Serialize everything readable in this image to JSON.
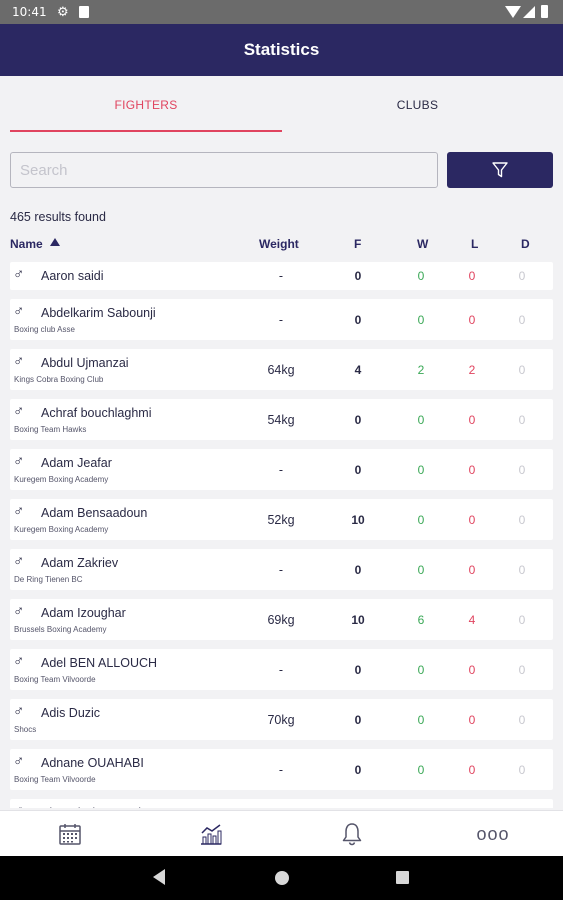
{
  "status_bar": {
    "time": "10:41"
  },
  "app_bar": {
    "title": "Statistics"
  },
  "tabs": [
    {
      "label": "FIGHTERS",
      "active": true
    },
    {
      "label": "CLUBS",
      "active": false
    }
  ],
  "search": {
    "placeholder": "Search",
    "value": ""
  },
  "filter_icon": "funnel-icon",
  "results_text": "465 results found",
  "columns": {
    "name": "Name",
    "weight": "Weight",
    "fights": "F",
    "wins": "W",
    "losses": "L",
    "draws": "D",
    "sort": "ascending"
  },
  "fighters": [
    {
      "name": "Aaron saidi",
      "club": "",
      "weight": "-",
      "f": "0",
      "w": "0",
      "l": "0",
      "d": "0"
    },
    {
      "name": "Abdelkarim Sabounji",
      "club": "Boxing club Asse",
      "weight": "-",
      "f": "0",
      "w": "0",
      "l": "0",
      "d": "0"
    },
    {
      "name": "Abdul Ujmanzai",
      "club": "Kings Cobra Boxing Club",
      "weight": "64kg",
      "f": "4",
      "w": "2",
      "l": "2",
      "d": "0"
    },
    {
      "name": "Achraf bouchlaghmi",
      "club": "Boxing Team Hawks",
      "weight": "54kg",
      "f": "0",
      "w": "0",
      "l": "0",
      "d": "0"
    },
    {
      "name": "Adam Jeafar",
      "club": "Kuregem Boxing Academy",
      "weight": "-",
      "f": "0",
      "w": "0",
      "l": "0",
      "d": "0"
    },
    {
      "name": "Adam Bensaadoun",
      "club": "Kuregem Boxing Academy",
      "weight": "52kg",
      "f": "10",
      "w": "0",
      "l": "0",
      "d": "0"
    },
    {
      "name": "Adam Zakriev",
      "club": "De Ring Tienen BC",
      "weight": "-",
      "f": "0",
      "w": "0",
      "l": "0",
      "d": "0"
    },
    {
      "name": "Adam Izoughar",
      "club": "Brussels Boxing Academy",
      "weight": "69kg",
      "f": "10",
      "w": "6",
      "l": "4",
      "d": "0"
    },
    {
      "name": "Adel BEN ALLOUCH",
      "club": "Boxing Team Vilvoorde",
      "weight": "-",
      "f": "0",
      "w": "0",
      "l": "0",
      "d": "0"
    },
    {
      "name": "Adis Duzic",
      "club": "Shocs",
      "weight": "70kg",
      "f": "0",
      "w": "0",
      "l": "0",
      "d": "0"
    },
    {
      "name": "Adnane OUAHABI",
      "club": "Boxing Team Vilvoorde",
      "weight": "-",
      "f": "0",
      "w": "0",
      "l": "0",
      "d": "0"
    },
    {
      "name": "Ahmed El Bettouti",
      "club": "",
      "weight": "",
      "f": "",
      "w": "",
      "l": "",
      "d": ""
    }
  ],
  "bottom_nav": [
    {
      "icon": "calendar-icon"
    },
    {
      "icon": "chart-icon"
    },
    {
      "icon": "bell-icon"
    },
    {
      "icon": "more-icon",
      "glyph": "ooo"
    }
  ],
  "colors": {
    "primary": "#2b2862",
    "accent": "#e0445f",
    "win": "#3aa856",
    "loss": "#e0445f",
    "draw": "#c8c8cf"
  }
}
